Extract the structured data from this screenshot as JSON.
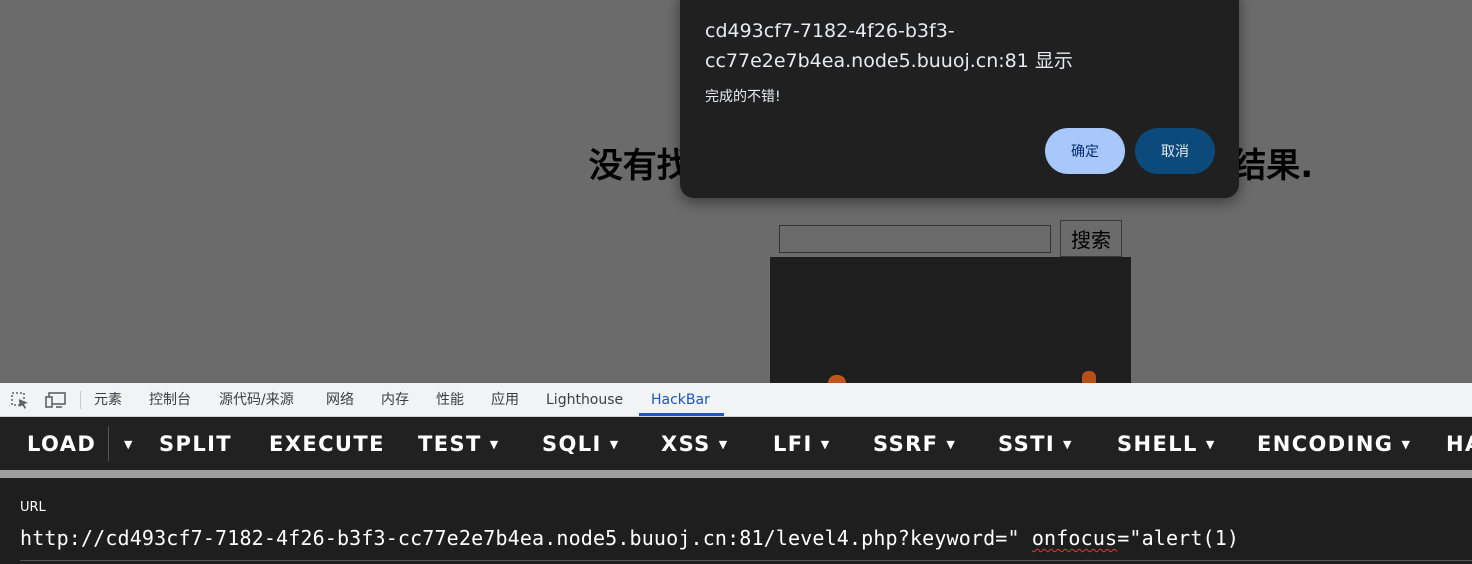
{
  "page": {
    "heading": "没有找到和\" onfocus=\"alert(1)相关的结果.",
    "search_button": "搜索"
  },
  "dialog": {
    "origin": "cd493cf7-7182-4f26-b3f3-cc77e2e7b4ea.node5.buuoj.cn:81 显示",
    "message": "完成的不错!",
    "ok_label": "确定",
    "cancel_label": "取消"
  },
  "devtools": {
    "tabs": [
      "元素",
      "控制台",
      "源代码/来源",
      "网络",
      "内存",
      "性能",
      "应用",
      "Lighthouse",
      "HackBar"
    ],
    "active_tab": "HackBar",
    "accent": "#1a56c4"
  },
  "hackbar": {
    "menu": [
      "LOAD",
      "SPLIT",
      "EXECUTE",
      "TEST",
      "SQLI",
      "XSS",
      "LFI",
      "SSRF",
      "SSTI",
      "SHELL",
      "ENCODING",
      "HA"
    ],
    "url_label": "URL",
    "url_prefix": "http://cd493cf7-7182-4f26-b3f3-cc77e2e7b4ea.node5.buuoj.cn:81/level4.php?keyword=\" ",
    "url_squiggle": "onfocus",
    "url_suffix": "=\"alert(1)"
  }
}
